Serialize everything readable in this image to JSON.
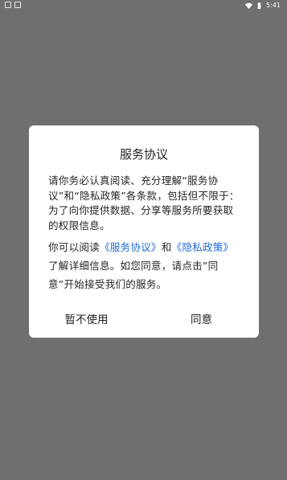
{
  "status_bar": {
    "time": "5:41",
    "icons": [
      "app-notification-icon",
      "app-notification-icon-2",
      "wifi-icon",
      "battery-icon"
    ]
  },
  "dialog": {
    "title": "服务协议",
    "paragraph1": "请你务必认真阅读、充分理解“服务协议”和“隐私政策”各条款，包括但不限于：为了向你提供数据、分享等服务所要获取的权限信息。",
    "paragraph2": {
      "prefix": "你可以阅读",
      "link1": "《服务协议》",
      "middle": "和",
      "link2": "《隐私政策》",
      "suffix": "了解详细信息。如您同意，请点击”同意”开始接受我们的服务。"
    },
    "buttons": {
      "decline": "暂不使用",
      "accept": "同意"
    }
  },
  "colors": {
    "overlay": "#6f6f6f",
    "dialog_bg": "#ffffff",
    "link": "#1f6bd6",
    "text": "#262626"
  }
}
